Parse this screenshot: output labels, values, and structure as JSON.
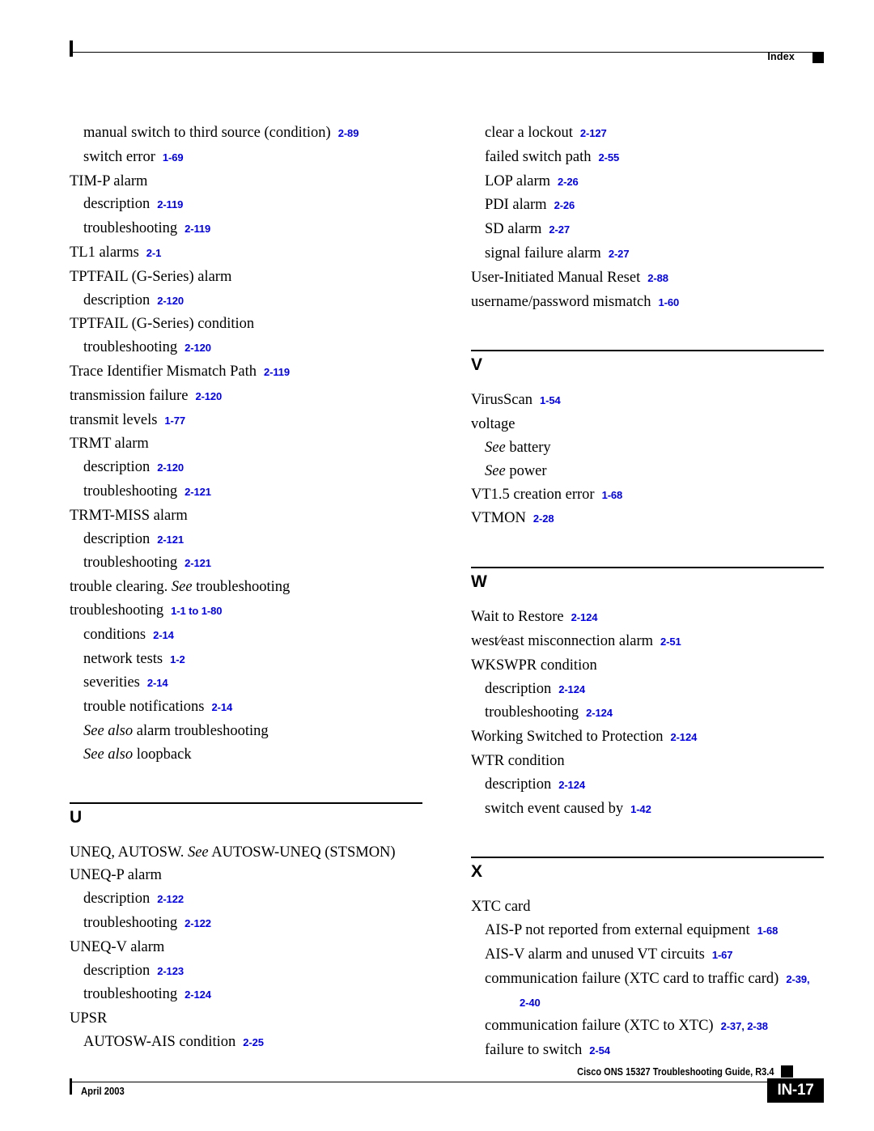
{
  "header": {
    "label": "Index",
    "marker_icon": "black-square-marker"
  },
  "footer": {
    "guide_title": "Cisco ONS 15327 Troubleshooting Guide, R3.4",
    "date": "April 2003",
    "page_number": "IN-17",
    "marker_icon": "black-square-marker"
  },
  "columns": [
    {
      "name": "left-column",
      "sections": [
        {
          "letter": null,
          "entries": [
            {
              "level": 1,
              "term": "manual switch to third source (condition)",
              "pages": "2-89"
            },
            {
              "level": 1,
              "term": "switch error",
              "pages": "1-69"
            },
            {
              "level": 0,
              "term": "TIM-P alarm",
              "pages": null
            },
            {
              "level": 1,
              "term": "description",
              "pages": "2-119"
            },
            {
              "level": 1,
              "term": "troubleshooting",
              "pages": "2-119"
            },
            {
              "level": 0,
              "term": "TL1 alarms",
              "pages": "2-1"
            },
            {
              "level": 0,
              "term": "TPTFAIL (G-Series) alarm",
              "pages": null
            },
            {
              "level": 1,
              "term": "description",
              "pages": "2-120"
            },
            {
              "level": 0,
              "term": "TPTFAIL (G-Series) condition",
              "pages": null
            },
            {
              "level": 1,
              "term": "troubleshooting",
              "pages": "2-120"
            },
            {
              "level": 0,
              "term": "Trace Identifier Mismatch Path",
              "pages": "2-119"
            },
            {
              "level": 0,
              "term": "transmission failure",
              "pages": "2-120"
            },
            {
              "level": 0,
              "term": "transmit levels",
              "pages": "1-77"
            },
            {
              "level": 0,
              "term": "TRMT alarm",
              "pages": null
            },
            {
              "level": 1,
              "term": "description",
              "pages": "2-120"
            },
            {
              "level": 1,
              "term": "troubleshooting",
              "pages": "2-121"
            },
            {
              "level": 0,
              "term": "TRMT-MISS alarm",
              "pages": null
            },
            {
              "level": 1,
              "term": "description",
              "pages": "2-121"
            },
            {
              "level": 1,
              "term": "troubleshooting",
              "pages": "2-121"
            },
            {
              "level": 0,
              "term": "trouble clearing. ",
              "see": "See",
              "term_after": " troubleshooting",
              "pages": null
            },
            {
              "level": 0,
              "term": "troubleshooting",
              "pages": "1-1 to 1-80"
            },
            {
              "level": 1,
              "term": "conditions",
              "pages": "2-14"
            },
            {
              "level": 1,
              "term": "network tests",
              "pages": "1-2"
            },
            {
              "level": 1,
              "term": "severities",
              "pages": "2-14"
            },
            {
              "level": 1,
              "term": "trouble notifications",
              "pages": "2-14"
            },
            {
              "level": 1,
              "term": "",
              "see": "See also",
              "term_after": " alarm troubleshooting",
              "pages": null
            },
            {
              "level": 1,
              "term": "",
              "see": "See also",
              "term_after": " loopback",
              "pages": null
            }
          ]
        },
        {
          "letter": "U",
          "entries": [
            {
              "level": 0,
              "term": "UNEQ, AUTOSW. ",
              "see": "See",
              "term_after": " AUTOSW-UNEQ (STSMON)",
              "pages": null
            },
            {
              "level": 0,
              "term": "UNEQ-P alarm",
              "pages": null
            },
            {
              "level": 1,
              "term": "description",
              "pages": "2-122"
            },
            {
              "level": 1,
              "term": "troubleshooting",
              "pages": "2-122"
            },
            {
              "level": 0,
              "term": "UNEQ-V alarm",
              "pages": null
            },
            {
              "level": 1,
              "term": "description",
              "pages": "2-123"
            },
            {
              "level": 1,
              "term": "troubleshooting",
              "pages": "2-124"
            },
            {
              "level": 0,
              "term": "UPSR",
              "pages": null
            },
            {
              "level": 1,
              "term": "AUTOSW-AIS condition",
              "pages": "2-25"
            }
          ]
        }
      ]
    },
    {
      "name": "right-column",
      "sections": [
        {
          "letter": null,
          "entries": [
            {
              "level": 1,
              "term": "clear a lockout",
              "pages": "2-127"
            },
            {
              "level": 1,
              "term": "failed switch path",
              "pages": "2-55"
            },
            {
              "level": 1,
              "term": "LOP alarm",
              "pages": "2-26"
            },
            {
              "level": 1,
              "term": "PDI alarm",
              "pages": "2-26"
            },
            {
              "level": 1,
              "term": "SD alarm",
              "pages": "2-27"
            },
            {
              "level": 1,
              "term": "signal failure alarm",
              "pages": "2-27"
            },
            {
              "level": 0,
              "term": "User-Initiated Manual Reset",
              "pages": "2-88"
            },
            {
              "level": 0,
              "term": "username/password mismatch",
              "pages": "1-60"
            }
          ]
        },
        {
          "letter": "V",
          "entries": [
            {
              "level": 0,
              "term": "VirusScan",
              "pages": "1-54"
            },
            {
              "level": 0,
              "term": "voltage",
              "pages": null
            },
            {
              "level": 1,
              "term": "",
              "see": "See",
              "term_after": " battery",
              "pages": null
            },
            {
              "level": 1,
              "term": "",
              "see": "See",
              "term_after": " power",
              "pages": null
            },
            {
              "level": 0,
              "term": "VT1.5 creation error",
              "pages": "1-68"
            },
            {
              "level": 0,
              "term": "VTMON",
              "pages": "2-28"
            }
          ]
        },
        {
          "letter": "W",
          "entries": [
            {
              "level": 0,
              "term": "Wait to Restore",
              "pages": "2-124"
            },
            {
              "level": 0,
              "term": "west⁄east misconnection alarm",
              "pages": "2-51"
            },
            {
              "level": 0,
              "term": "WKSWPR condition",
              "pages": null
            },
            {
              "level": 1,
              "term": "description",
              "pages": "2-124"
            },
            {
              "level": 1,
              "term": "troubleshooting",
              "pages": "2-124"
            },
            {
              "level": 0,
              "term": "Working Switched to Protection",
              "pages": "2-124"
            },
            {
              "level": 0,
              "term": "WTR condition",
              "pages": null
            },
            {
              "level": 1,
              "term": "description",
              "pages": "2-124"
            },
            {
              "level": 1,
              "term": "switch event caused by",
              "pages": "1-42"
            }
          ]
        },
        {
          "letter": "X",
          "entries": [
            {
              "level": 0,
              "term": "XTC card",
              "pages": null
            },
            {
              "level": 1,
              "term": "AIS-P not reported from external equipment",
              "pages": "1-68"
            },
            {
              "level": 1,
              "term": "AIS-V alarm and unused VT circuits",
              "pages": "1-67"
            },
            {
              "level": 1,
              "term": "communication failure (XTC card to traffic card)",
              "pages": "2-39,",
              "pages_cont": "2-40"
            },
            {
              "level": 1,
              "term": "communication failure (XTC to XTC)",
              "pages": "2-37, 2-38"
            },
            {
              "level": 1,
              "term": "failure to switch",
              "pages": "2-54"
            }
          ]
        }
      ]
    }
  ]
}
